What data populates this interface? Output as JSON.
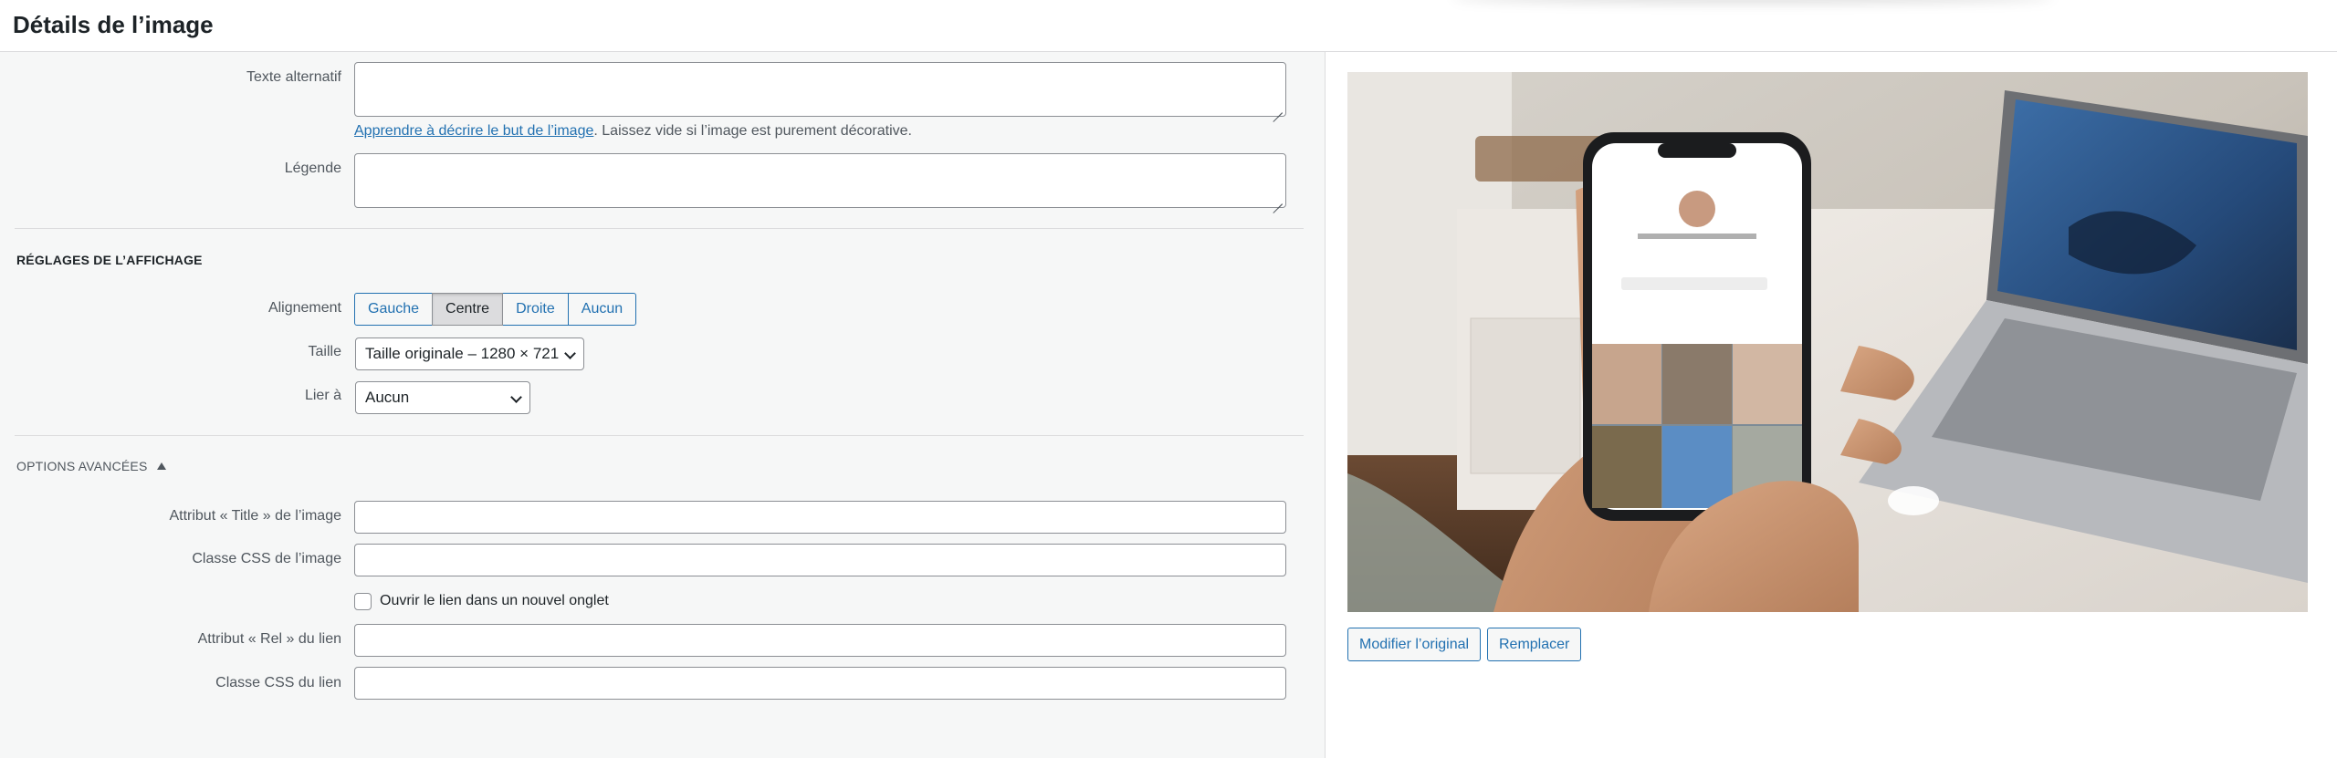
{
  "page": {
    "title": "Détails de l’image"
  },
  "fields": {
    "alt_label": "Texte alternatif",
    "alt_value": "",
    "help_link": "Apprendre à décrire le but de l’image",
    "help_text": ". Laissez vide si l’image est purement décorative.",
    "caption_label": "Légende",
    "caption_value": ""
  },
  "display": {
    "section_title": "Réglages de l’affichage",
    "alignment_label": "Alignement",
    "alignment_options": [
      "Gauche",
      "Centre",
      "Droite",
      "Aucun"
    ],
    "alignment_selected": "Centre",
    "size_label": "Taille",
    "size_value": "Taille originale – 1280 × 721",
    "link_label": "Lier à",
    "link_value": "Aucun"
  },
  "advanced": {
    "section_title": "Options avancées",
    "title_attr_label": "Attribut « Title » de l’image",
    "title_attr_value": "",
    "img_css_label": "Classe CSS de l’image",
    "img_css_value": "",
    "new_tab_label": "Ouvrir le lien dans un nouvel onglet",
    "new_tab_checked": false,
    "rel_label": "Attribut « Rel » du lien",
    "rel_value": "",
    "link_css_label": "Classe CSS du lien",
    "link_css_value": ""
  },
  "preview": {
    "edit_button": "Modifier l’original",
    "replace_button": "Remplacer"
  },
  "colors": {
    "accent": "#2271b1",
    "panel_bg": "#f6f7f7",
    "border": "#8c8f94"
  },
  "icons": {
    "dropdown": "chevron-down-icon",
    "disclosure": "triangle-up-icon",
    "resize": "resize-grip-icon"
  }
}
